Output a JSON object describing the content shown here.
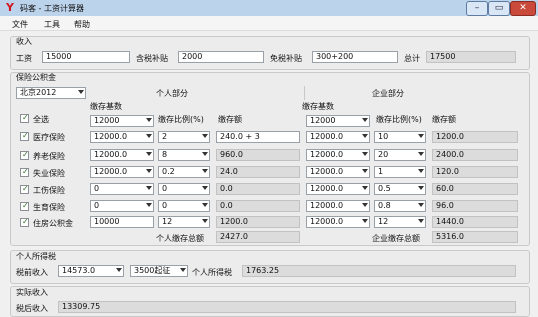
{
  "window": {
    "title": "码客 - 工资计算器",
    "app_icon": "Y"
  },
  "menu": [
    "文件",
    "工具",
    "帮助"
  ],
  "income": {
    "title": "收入",
    "salary_label": "工资",
    "salary": "15000",
    "taxed_allowance_label": "含税补贴",
    "taxed_allowance": "2000",
    "taxfree_allowance_label": "免税补贴",
    "taxfree_allowance": "300+200",
    "total_label": "总计",
    "total": "17500"
  },
  "insurance": {
    "title": "保险公积金",
    "city": "北京2012",
    "select_all": "全选",
    "personal_title": "个人部分",
    "company_title": "企业部分",
    "hdr_base": "缴存基数",
    "hdr_ratio": "缴存比例(%)",
    "hdr_amount": "缴存额",
    "personal_base_default": "12000",
    "company_base_default": "12000",
    "rows": [
      {
        "name": "医疗保险",
        "p_base": "12000.0",
        "p_ratio": "2",
        "p_amount": "240.0 + 3",
        "c_base": "12000.0",
        "c_ratio": "10",
        "c_amount": "1200.0"
      },
      {
        "name": "养老保险",
        "p_base": "12000.0",
        "p_ratio": "8",
        "p_amount": "960.0",
        "c_base": "12000.0",
        "c_ratio": "20",
        "c_amount": "2400.0"
      },
      {
        "name": "失业保险",
        "p_base": "12000.0",
        "p_ratio": "0.2",
        "p_amount": "24.0",
        "c_base": "12000.0",
        "c_ratio": "1",
        "c_amount": "120.0"
      },
      {
        "name": "工伤保险",
        "p_base": "0",
        "p_ratio": "0",
        "p_amount": "0.0",
        "c_base": "12000.0",
        "c_ratio": "0.5",
        "c_amount": "60.0"
      },
      {
        "name": "生育保险",
        "p_base": "0",
        "p_ratio": "0",
        "p_amount": "0.0",
        "c_base": "12000.0",
        "c_ratio": "0.8",
        "c_amount": "96.0"
      },
      {
        "name": "住房公积金",
        "p_base": "10000",
        "p_ratio": "12",
        "p_amount": "1200.0",
        "c_base": "12000.0",
        "c_ratio": "12",
        "c_amount": "1440.0"
      }
    ],
    "personal_total_label": "个人缴存总额",
    "personal_total": "2427.0",
    "company_total_label": "企业缴存总额",
    "company_total": "5316.0"
  },
  "tax": {
    "title": "个人所得税",
    "pretax_label": "税前收入",
    "pretax": "14573.0",
    "threshold": "3500起征",
    "tax_label": "个人所得税",
    "tax": "1763.25"
  },
  "net": {
    "title": "实际收入",
    "after_tax_label": "税后收入",
    "after_tax": "13309.75"
  }
}
